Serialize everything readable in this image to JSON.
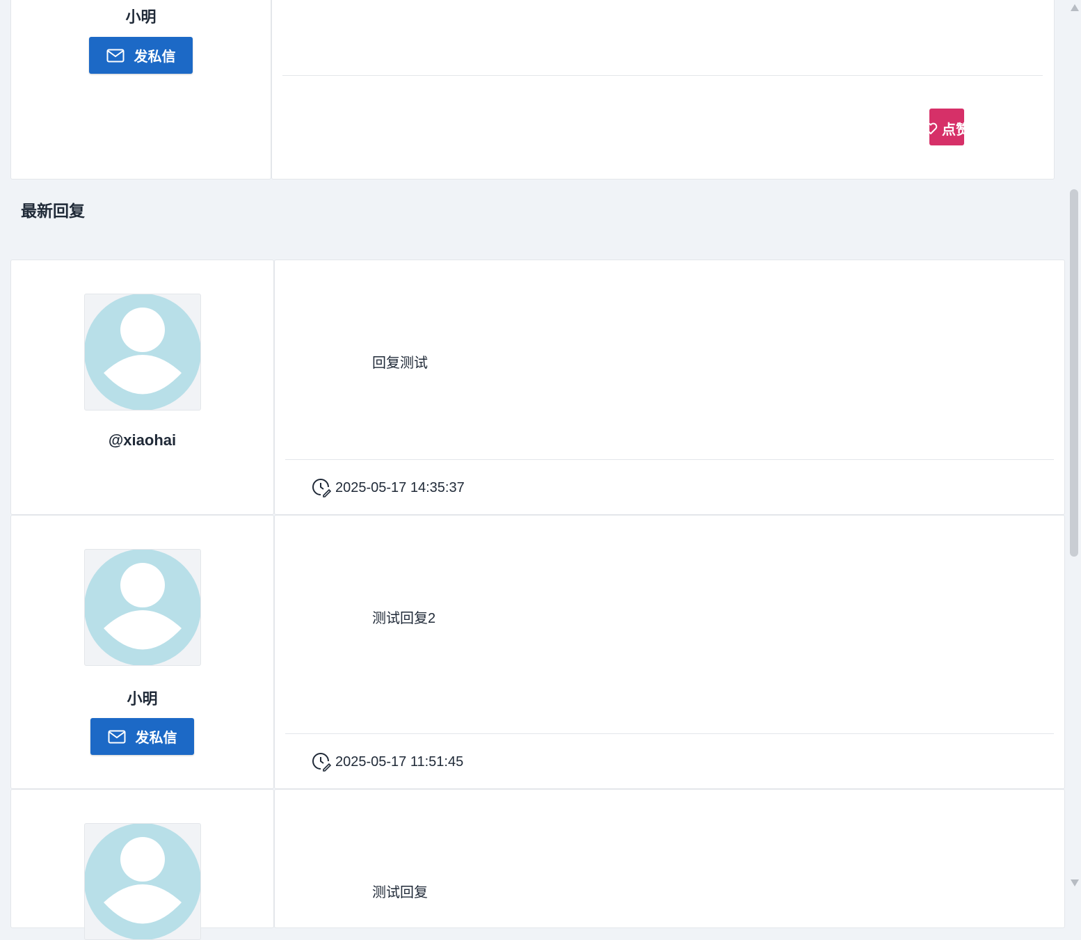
{
  "top_post": {
    "author_name": "小明",
    "pm_label": "发私信",
    "like_label": "点赞"
  },
  "section": {
    "title": "最新回复"
  },
  "replies": [
    {
      "author": "@xiaohai",
      "content": "回复测试",
      "time": "2025-05-17 14:35:37"
    },
    {
      "author": "小明",
      "pm_label": "发私信",
      "content": "测试回复2",
      "time": "2025-05-17 11:51:45"
    },
    {
      "content": "测试回复"
    }
  ],
  "colors": {
    "primary": "#1c69c6",
    "like": "#d63068",
    "avatar": "#b8dfe8",
    "background": "#f0f3f7"
  }
}
